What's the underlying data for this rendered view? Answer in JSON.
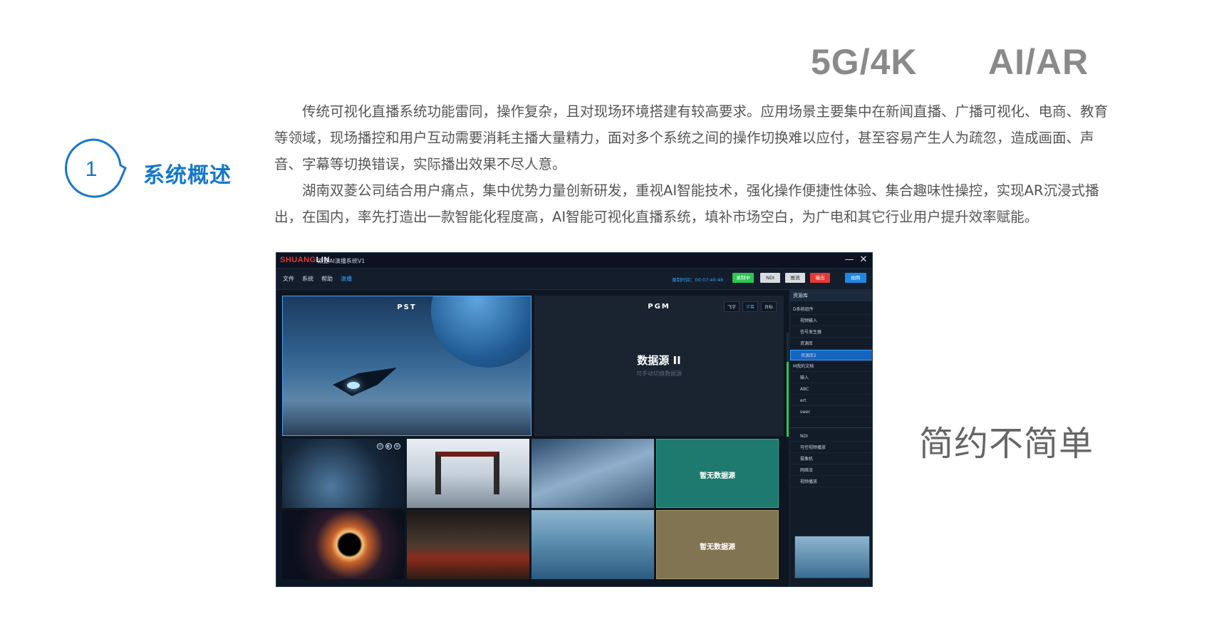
{
  "taglines": {
    "left": "5G/4K",
    "right": "AI/AR"
  },
  "section": {
    "number": "1",
    "title": "系统概述"
  },
  "intro": {
    "para1": "传统可视化直播系统功能雷同，操作复杂，且对现场环境搭建有较高要求。应用场景主要集中在新闻直播、广播可视化、电商、教育等领域，现场播控和用户互动需要消耗主播大量精力，面对多个系统之间的操作切换难以应付，甚至容易产生人为疏忽，造成画面、声音、字幕等切换错误，实际播出效果不尽人意。",
    "para2": "湖南双菱公司结合用户痛点，集中优势力量创新研发，重视AI智能技术，强化操作便捷性体验、集合趣味性操控，实现AR沉浸式播出，在国内，率先打造出一款智能化程度高，AI智能可视化直播系统，填补市场空白，为广电和其它行业用户提升效率赋能。"
  },
  "slogan": "简约不简单",
  "app": {
    "logo_red": "SHUANG",
    "logo_white": "LIN",
    "title": "双菱AI演播系统V1",
    "window_controls": {
      "minimize": "—",
      "close": "✕"
    },
    "menu": [
      "文件",
      "系统",
      "帮助",
      "演播"
    ],
    "active_menu": "演播",
    "record_time": "录制时间：00:07:40:48",
    "toolbar": {
      "recording": "录制中",
      "ndi": "NDI",
      "push": "推流",
      "output": "输出",
      "shoot": "拍照"
    },
    "pst_label": "PST",
    "pgm_label": "PGM",
    "pgm_tabs": [
      "飞字",
      "字幕",
      "台标"
    ],
    "pgm_active_tab": "字幕",
    "pgm_source": "数据源 II",
    "pgm_hint": "可手动切换数据源",
    "thumb_icons": [
      "⊙",
      "◐",
      "⊛"
    ],
    "empty_source": "暂无数据源",
    "audio_level": 0.72,
    "resource_panel": {
      "header": "资源库",
      "items": [
        {
          "label": "D系统组件",
          "type": "group"
        },
        {
          "label": "视频输入",
          "type": "sub"
        },
        {
          "label": "信号发生器",
          "type": "sub"
        },
        {
          "label": "资源库",
          "type": "sub"
        },
        {
          "label": "资源库2",
          "type": "sub",
          "selected": true
        },
        {
          "label": "M我的文档",
          "type": "group"
        },
        {
          "label": "输入",
          "type": "sub"
        },
        {
          "label": "ABC",
          "type": "sub"
        },
        {
          "label": "ert",
          "type": "sub"
        },
        {
          "label": "swer",
          "type": "sub"
        }
      ],
      "items2": [
        "NDI",
        "可控视频播放",
        "摄像机",
        "网络流",
        "视频播放"
      ]
    }
  }
}
